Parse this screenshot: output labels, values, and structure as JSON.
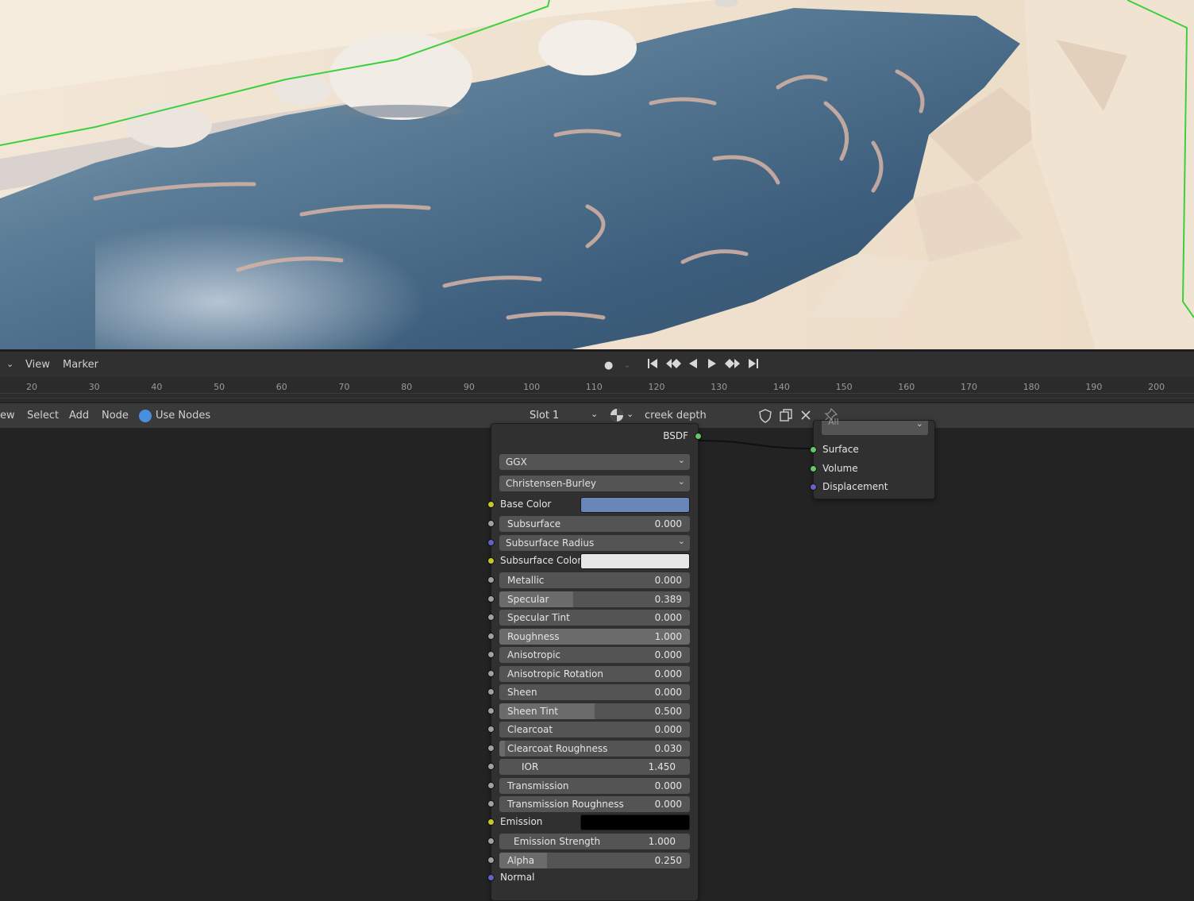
{
  "timeline": {
    "menu": [
      "View",
      "Marker"
    ],
    "controls": {
      "record": "●",
      "jump_start": "⏮",
      "prev_key": "◆",
      "play_reverse": "◀",
      "play": "▶",
      "next_key": "◆",
      "jump_end": "⏭"
    },
    "ruler_ticks": [
      "20",
      "30",
      "40",
      "50",
      "60",
      "70",
      "80",
      "90",
      "100",
      "110",
      "120",
      "130",
      "140",
      "150",
      "160",
      "170",
      "180",
      "190",
      "200"
    ]
  },
  "node_editor": {
    "menu": [
      "ew",
      "Select",
      "Add",
      "Node"
    ],
    "use_nodes_label": "Use Nodes",
    "slot_label": "Slot 1",
    "material_name": "creek depth",
    "icons": {
      "shield": "shield-icon",
      "copy": "copy-icon",
      "close": "close-icon",
      "pin": "pin-icon"
    }
  },
  "bsdf_node": {
    "output_label": "BSDF",
    "distribution": "GGX",
    "subsurface_method": "Christensen-Burley",
    "base_color_label": "Base Color",
    "base_color": "#6a85b8",
    "subsurface_radius_label": "Subsurface Radius",
    "subsurface_color_label": "Subsurface Color",
    "subsurface_color": "#e6e6e6",
    "emission_label": "Emission",
    "emission_color": "#000000",
    "normal_label": "Normal",
    "properties": [
      {
        "label": "Subsurface",
        "value": "0.000",
        "fraction": 0.0
      },
      {
        "label": "Metallic",
        "value": "0.000",
        "fraction": 0.0
      },
      {
        "label": "Specular",
        "value": "0.389",
        "fraction": 0.389
      },
      {
        "label": "Specular Tint",
        "value": "0.000",
        "fraction": 0.0
      },
      {
        "label": "Roughness",
        "value": "1.000",
        "fraction": 1.0
      },
      {
        "label": "Anisotropic",
        "value": "0.000",
        "fraction": 0.0
      },
      {
        "label": "Anisotropic Rotation",
        "value": "0.000",
        "fraction": 0.0
      },
      {
        "label": "Sheen",
        "value": "0.000",
        "fraction": 0.0
      },
      {
        "label": "Sheen Tint",
        "value": "0.500",
        "fraction": 0.5
      },
      {
        "label": "Clearcoat",
        "value": "0.000",
        "fraction": 0.0
      },
      {
        "label": "Clearcoat Roughness",
        "value": "0.030",
        "fraction": 0.03
      },
      {
        "label": "IOR",
        "value": "1.450",
        "fraction": 0.0
      },
      {
        "label": "Transmission",
        "value": "0.000",
        "fraction": 0.0
      },
      {
        "label": "Transmission Roughness",
        "value": "0.000",
        "fraction": 0.0
      },
      {
        "label": "Emission Strength",
        "value": "1.000",
        "fraction": 0.0
      },
      {
        "label": "Alpha",
        "value": "0.250",
        "fraction": 0.25
      }
    ]
  },
  "output_node": {
    "target": "All",
    "inputs": [
      "Surface",
      "Volume",
      "Displacement"
    ]
  },
  "colors": {
    "accent": "#4a8ee0",
    "link": "#101010"
  }
}
